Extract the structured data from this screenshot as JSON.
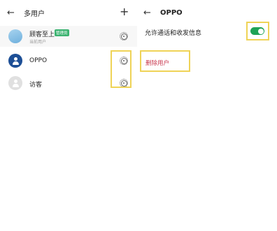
{
  "left": {
    "title": "多用户",
    "users": [
      {
        "name": "顾客至上",
        "badge": "管理员",
        "subtitle": "当前用户"
      },
      {
        "name": "OPPO"
      },
      {
        "name": "访客"
      }
    ]
  },
  "right": {
    "title": "OPPO",
    "allow_calls_label": "允许通话和收发信息",
    "allow_calls_on": true,
    "delete_user_label": "删除用户"
  },
  "colors": {
    "toggle_on": "#1ea356",
    "highlight_box": "#efd357",
    "delete_text": "#c93a4f",
    "badge": "#3cb371"
  }
}
